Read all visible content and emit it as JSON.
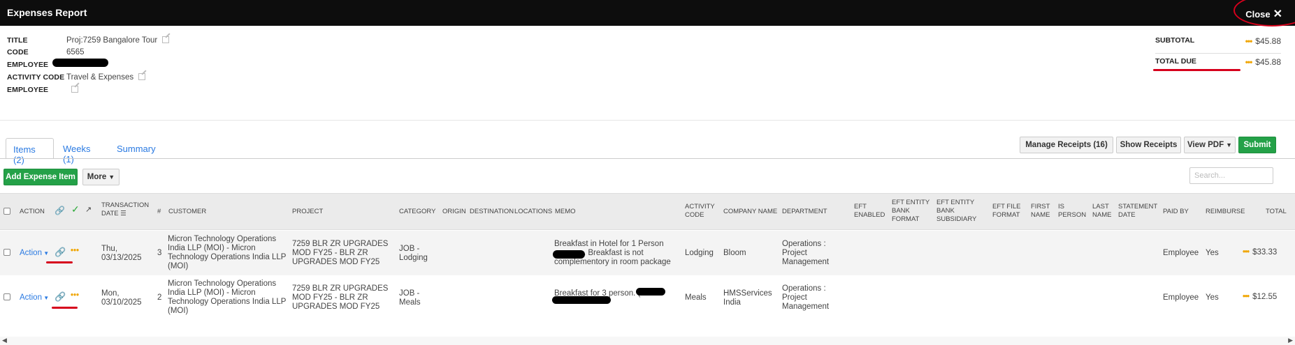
{
  "header": {
    "title": "Expenses Report",
    "close_label": "Close"
  },
  "fields": [
    {
      "label": "TITLE",
      "value": "Proj:7259 Bangalore Tour"
    },
    {
      "label": "CODE",
      "value": "6565"
    },
    {
      "label": "EMPLOYEE",
      "value": ""
    },
    {
      "label": "ACTIVITY CODE",
      "value": "Travel & Expenses"
    },
    {
      "label": "EMPLOYEE",
      "value": ""
    }
  ],
  "totals": {
    "subtotal_label": "SUBTOTAL",
    "subtotal_value": "$45.88",
    "total_due_label": "TOTAL DUE",
    "total_due_value": "$45.88"
  },
  "tabs": [
    "Items (2)",
    "Weeks (1)",
    "Summary"
  ],
  "toolbar": {
    "manage_receipts": "Manage Receipts (16)",
    "show_receipts": "Show Receipts",
    "view_pdf": "View PDF",
    "submit": "Submit",
    "add_expense": "Add Expense Item",
    "more": "More",
    "search_placeholder": "Search..."
  },
  "columns": {
    "action": "ACTION",
    "txn_date_1": "TRANSACTION",
    "txn_date_2": "DATE",
    "num": "#",
    "customer": "CUSTOMER",
    "project": "PROJECT",
    "category": "CATEGORY",
    "origin": "ORIGIN",
    "destination": "DESTINATION",
    "locations": "LOCATIONS",
    "memo": "MEMO",
    "activity_code_1": "ACTIVITY",
    "activity_code_2": "CODE",
    "company_name": "COMPANY NAME",
    "department": "DEPARTMENT",
    "eft_enabled_1": "EFT",
    "eft_enabled_2": "ENABLED",
    "eft_bank_format_1": "EFT ENTITY",
    "eft_bank_format_2": "BANK",
    "eft_bank_format_3": "FORMAT",
    "eft_bank_sub_1": "EFT ENTITY",
    "eft_bank_sub_2": "BANK",
    "eft_bank_sub_3": "SUBSIDIARY",
    "eft_file_format_1": "EFT FILE",
    "eft_file_format_2": "FORMAT",
    "first_name_1": "FIRST",
    "first_name_2": "NAME",
    "is_person_1": "IS",
    "is_person_2": "PERSON",
    "last_name_1": "LAST",
    "last_name_2": "NAME",
    "statement_date_1": "STATEMENT",
    "statement_date_2": "DATE",
    "paid_by": "PAID BY",
    "reimburse": "REIMBURSE",
    "total": "TOTAL"
  },
  "rows": [
    {
      "action": "Action",
      "date_1": "Thu,",
      "date_2": "03/13/2025",
      "num": "3",
      "customer_1": "Micron Technology Operations",
      "customer_2": "India LLP (MOI) - Micron",
      "customer_3": "Technology Operations India LLP",
      "customer_4": "(MOI)",
      "project_1": "7259 BLR ZR UPGRADES",
      "project_2": "MOD FY25 - BLR ZR",
      "project_3": "UPGRADES MOD FY25",
      "category_1": "JOB -",
      "category_2": "Lodging",
      "memo_1": "Breakfast in Hotel for 1 Person",
      "memo_2": ". Breakfast is not",
      "memo_3": "complementory in room package",
      "activity_code": "Lodging",
      "company_name_1": "Bloom",
      "company_name_2": "",
      "department_1": "Operations :",
      "department_2": "Project",
      "department_3": "Management",
      "paid_by": "Employee",
      "reimburse": "Yes",
      "total": "$33.33"
    },
    {
      "action": "Action",
      "date_1": "Mon,",
      "date_2": "03/10/2025",
      "num": "2",
      "customer_1": "Micron Technology Operations",
      "customer_2": "India LLP (MOI) - Micron",
      "customer_3": "Technology Operations India LLP",
      "customer_4": "(MOI)",
      "project_1": "7259 BLR ZR UPGRADES",
      "project_2": "MOD FY25 - BLR ZR",
      "project_3": "UPGRADES MOD FY25",
      "category_1": "JOB -",
      "category_2": "Meals",
      "memo_1": "Breakfast for 3 person. (R",
      "memo_2": "",
      "memo_3": "",
      "activity_code": "Meals",
      "company_name_1": "HMSServices",
      "company_name_2": "India",
      "department_1": "Operations :",
      "department_2": "Project",
      "department_3": "Management",
      "paid_by": "Employee",
      "reimburse": "Yes",
      "total": "$12.55"
    }
  ],
  "colors": {
    "accent_blue": "#2a7ae2",
    "green": "#24a148",
    "annotation_red": "#d6001c",
    "dots_orange": "#f0a500"
  }
}
